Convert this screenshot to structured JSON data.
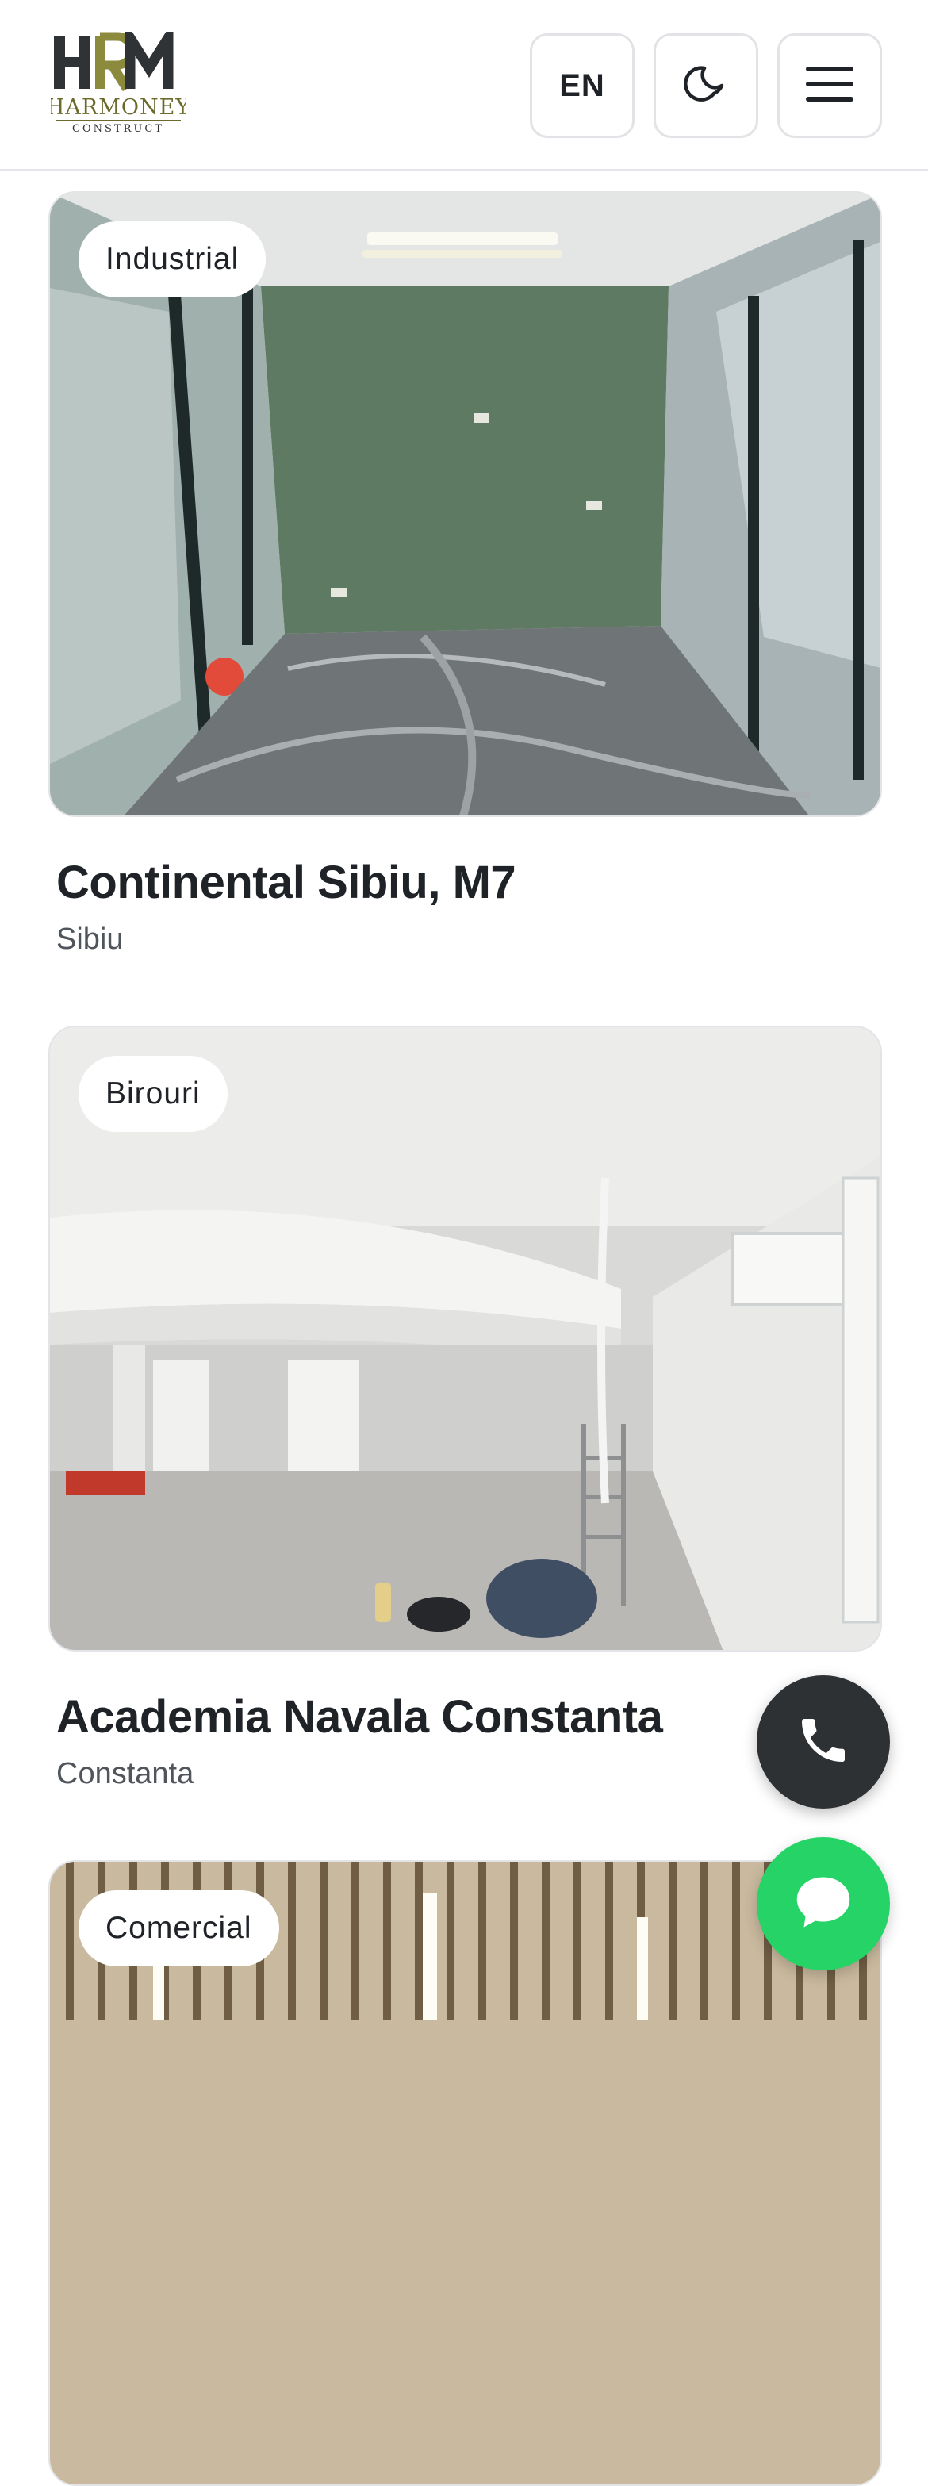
{
  "header": {
    "logo": {
      "monogram": "HRM",
      "name": "HARMONEY",
      "tagline": "CONSTRUCT"
    },
    "language_label": "EN",
    "theme_icon": "moon-icon",
    "menu_icon": "hamburger-icon"
  },
  "projects": [
    {
      "category": "Industrial",
      "title": "Continental Sibiu, M7",
      "city": "Sibiu"
    },
    {
      "category": "Birouri",
      "title": "Academia Navala Constanta",
      "city": "Constanta"
    },
    {
      "category": "Comercial",
      "title": "",
      "city": ""
    }
  ],
  "floating_actions": {
    "phone_icon": "phone-icon",
    "chat_icon": "chat-bubble-icon"
  },
  "colors": {
    "text": "#1f2328",
    "secondary_text": "#50555c",
    "logo_olive": "#8c8a3c",
    "phone_button": "#2d3134",
    "chat_button": "#25d366"
  }
}
